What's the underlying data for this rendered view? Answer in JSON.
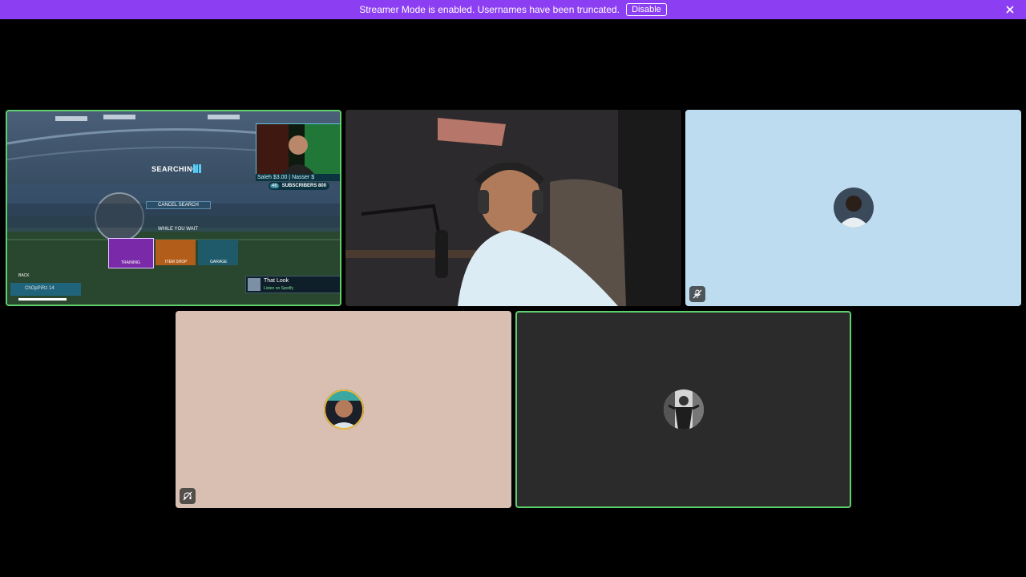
{
  "banner": {
    "message": "Streamer Mode is enabled. Usernames have been truncated.",
    "disable_label": "Disable",
    "color": "#8c3ff2"
  },
  "tiles": {
    "screen_share": {
      "status": "SEARCHING",
      "cancel_label": "CANCEL SEARCH",
      "while_label": "WHILE YOU WAIT",
      "menu": [
        "TRAINING",
        "ITEM SHOP",
        "GARAGE"
      ],
      "back_label": "BACK",
      "player_name": "ChOpPiRz 14",
      "subscribers_label": "SUBSCRIBERS 800",
      "subscribers_badge": "46",
      "donation_ticker": "Saleh $3.00 | Nasser $",
      "song_title": "That Look",
      "song_source": "Listen on Spotify"
    },
    "camera": {},
    "user_blue": {
      "bg": "#bedcf0"
    },
    "user_beige": {
      "bg": "#d8bfb2"
    },
    "user_dark": {
      "bg": "#2b2b2b"
    }
  },
  "colors": {
    "speaking_border": "#5fd06d"
  }
}
